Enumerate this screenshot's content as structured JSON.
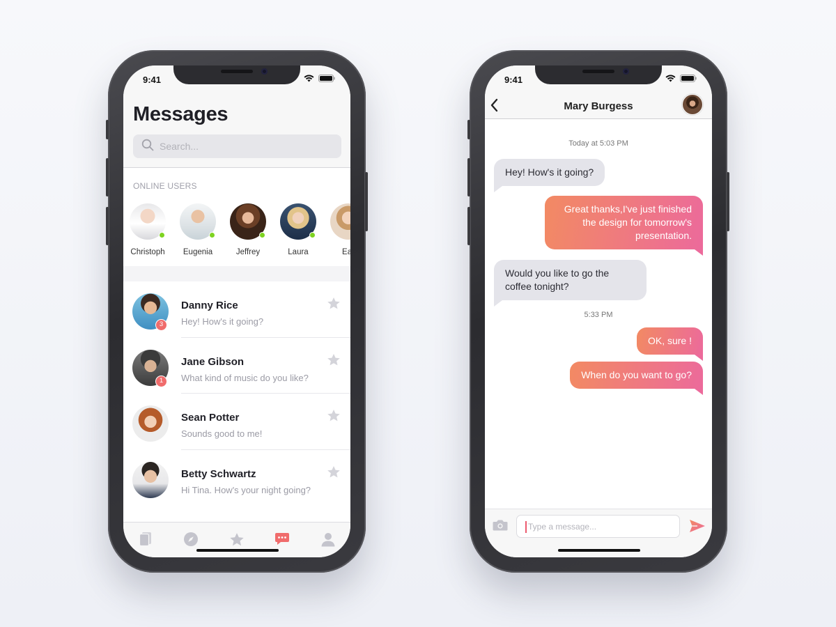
{
  "status_bar": {
    "time": "9:41"
  },
  "messages_screen": {
    "title": "Messages",
    "search": {
      "placeholder": "Search..."
    },
    "online_users": {
      "title": "ONLINE USERS",
      "users": [
        {
          "name": "Christoph",
          "online": true
        },
        {
          "name": "Eugenia",
          "online": true
        },
        {
          "name": "Jeffrey",
          "online": true
        },
        {
          "name": "Laura",
          "online": true
        },
        {
          "name": "Ear",
          "online": false
        }
      ]
    },
    "conversations": [
      {
        "name": "Danny Rice",
        "preview": "Hey! How's it going?",
        "unread": "3"
      },
      {
        "name": "Jane Gibson",
        "preview": "What kind of music do you like?",
        "unread": "1"
      },
      {
        "name": "Sean Potter",
        "preview": "Sounds good to me!",
        "unread": ""
      },
      {
        "name": "Betty Schwartz",
        "preview": "Hi Tina. How's your night going?",
        "unread": ""
      }
    ],
    "tab_bar": {
      "tabs": [
        {
          "icon": "cards-icon",
          "active": false
        },
        {
          "icon": "compass-icon",
          "active": false
        },
        {
          "icon": "star-icon",
          "active": false
        },
        {
          "icon": "chat-icon",
          "active": true
        },
        {
          "icon": "profile-icon",
          "active": false
        }
      ]
    }
  },
  "chat_screen": {
    "contact_name": "Mary Burgess",
    "messages": [
      {
        "type": "timestamp",
        "text": "Today at 5:03 PM"
      },
      {
        "type": "incoming",
        "text": "Hey! How's it going?"
      },
      {
        "type": "outgoing",
        "text": "Great thanks,I've just finished the design for tomorrow's presentation."
      },
      {
        "type": "incoming",
        "text": "Would you like to go the coffee tonight?"
      },
      {
        "type": "timestamp",
        "text": "5:33 PM"
      },
      {
        "type": "outgoing",
        "text": "OK, sure !"
      },
      {
        "type": "outgoing",
        "text": "When do you want to go?"
      }
    ],
    "composer": {
      "placeholder": "Type a message..."
    }
  },
  "colors": {
    "accent_gradient_start": "#f28a63",
    "accent_gradient_end": "#ec6a9b",
    "online_dot": "#7ed321",
    "badge": "#f06c6c",
    "active_tab": "#f06c6c",
    "inactive_icon": "#c4c4cc"
  }
}
